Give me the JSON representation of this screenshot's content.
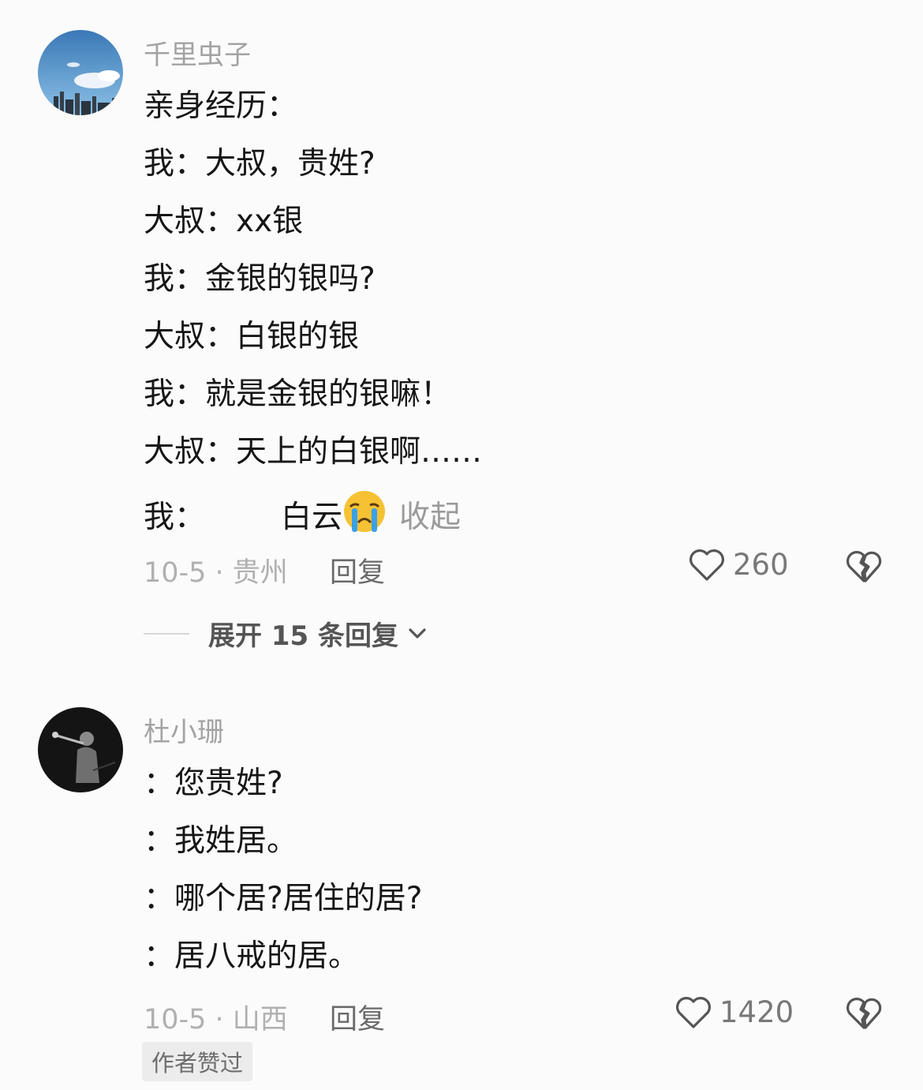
{
  "comments": [
    {
      "username": "千里虫子",
      "avatar_icon": "sky-cityscape-avatar",
      "lines": [
        "亲身经历：",
        "我：大叔，贵姓?",
        "大叔：xx银",
        "我：金银的银吗?",
        "大叔：白银的银",
        "我：就是金银的银嘛！",
        "大叔：天上的白银啊……"
      ],
      "last_line": {
        "prefix": "我：",
        "text": "白云",
        "emoji": "crying-face-emoji",
        "collapse": "收起"
      },
      "date_location": "10-5 · 贵州",
      "reply": "回复",
      "likes": "260",
      "expand_replies": "展开 15 条回复"
    },
    {
      "username": "杜小珊",
      "avatar_icon": "dark-musician-avatar",
      "lines": [
        "：您贵姓?",
        "：我姓居。",
        "：哪个居?居住的居?",
        "：居八戒的居。"
      ],
      "date_location": "10-5 · 山西",
      "reply": "回复",
      "likes": "1420",
      "badge": "作者赞过"
    }
  ],
  "colors": {
    "background": "#fbfbfb",
    "username": "#a3a3a3",
    "body_text": "#161616",
    "meta_text": "#b0b0b0"
  }
}
